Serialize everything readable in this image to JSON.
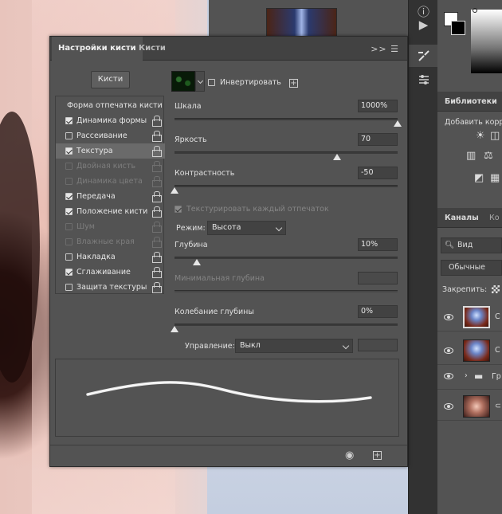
{
  "panel": {
    "tabs": [
      "Настройки кисти",
      "Кисти"
    ],
    "menu_glyphs": ">>",
    "brushes_button": "Кисти",
    "list_header": "Форма отпечатка кисти",
    "list": [
      {
        "label": "Динамика формы",
        "checked": true,
        "enabled": true,
        "selected": false
      },
      {
        "label": "Рассеивание",
        "checked": false,
        "enabled": true,
        "selected": false
      },
      {
        "label": "Текстура",
        "checked": true,
        "enabled": true,
        "selected": true
      },
      {
        "label": "Двойная кисть",
        "checked": false,
        "enabled": false,
        "selected": false
      },
      {
        "label": "Динамика цвета",
        "checked": false,
        "enabled": false,
        "selected": false
      },
      {
        "label": "Передача",
        "checked": true,
        "enabled": true,
        "selected": false
      },
      {
        "label": "Положение кисти",
        "checked": true,
        "enabled": true,
        "selected": false
      },
      {
        "label": "Шум",
        "checked": false,
        "enabled": false,
        "selected": false
      },
      {
        "label": "Влажные края",
        "checked": false,
        "enabled": false,
        "selected": false
      },
      {
        "label": "Накладка",
        "checked": false,
        "enabled": true,
        "selected": false
      },
      {
        "label": "Сглаживание",
        "checked": true,
        "enabled": true,
        "selected": false
      },
      {
        "label": "Защита текстуры",
        "checked": false,
        "enabled": true,
        "selected": false
      }
    ],
    "invert_label": "Инвертировать",
    "scale": {
      "label": "Шкала",
      "value": "1000%",
      "level": 1.0
    },
    "brightness": {
      "label": "Яркость",
      "value": "70",
      "level": 0.73
    },
    "contrast": {
      "label": "Контрастность",
      "value": "-50",
      "level": 0.0
    },
    "texturize_each": "Текстурировать каждый отпечаток",
    "mode": {
      "label": "Режим:",
      "value": "Высота"
    },
    "depth": {
      "label": "Глубина",
      "value": "10%",
      "level": 0.1
    },
    "min_depth": {
      "label": "Минимальная глубина",
      "value": ""
    },
    "depth_jitter": {
      "label": "Колебание глубины",
      "value": "0%",
      "level": 0.0
    },
    "control": {
      "label": "Управление:",
      "value": "Выкл"
    }
  },
  "right": {
    "libraries_tab": "Библиотеки",
    "add_adjust": "Добавить корре",
    "channels_tab": "Каналы",
    "channels_tab2": "Ко",
    "search_kind": "Вид",
    "blend": "Обычные",
    "lock_label": "Закрепить:",
    "layer_names": [
      "С",
      "С",
      "Гр",
      ""
    ]
  },
  "colors": {
    "panel_bg": "#535353",
    "tab_bg": "#424242",
    "field_bg": "#424242"
  }
}
